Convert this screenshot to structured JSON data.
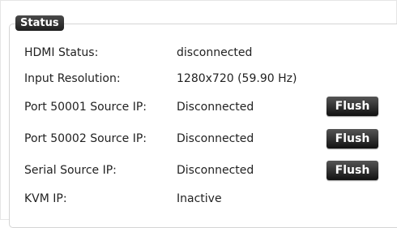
{
  "section": {
    "title": "Status"
  },
  "rows": {
    "hdmi": {
      "label": "HDMI Status:",
      "value": "disconnected"
    },
    "resolution": {
      "label": "Input Resolution:",
      "value": "1280x720 (59.90 Hz)"
    },
    "port50001": {
      "label": "Port 50001 Source IP:",
      "value": "Disconnected",
      "button": "Flush"
    },
    "port50002": {
      "label": "Port 50002 Source IP:",
      "value": "Disconnected",
      "button": "Flush"
    },
    "serial": {
      "label": "Serial Source IP:",
      "value": "Disconnected",
      "button": "Flush"
    },
    "kvm": {
      "label": "KVM IP:",
      "value": "Inactive"
    }
  }
}
